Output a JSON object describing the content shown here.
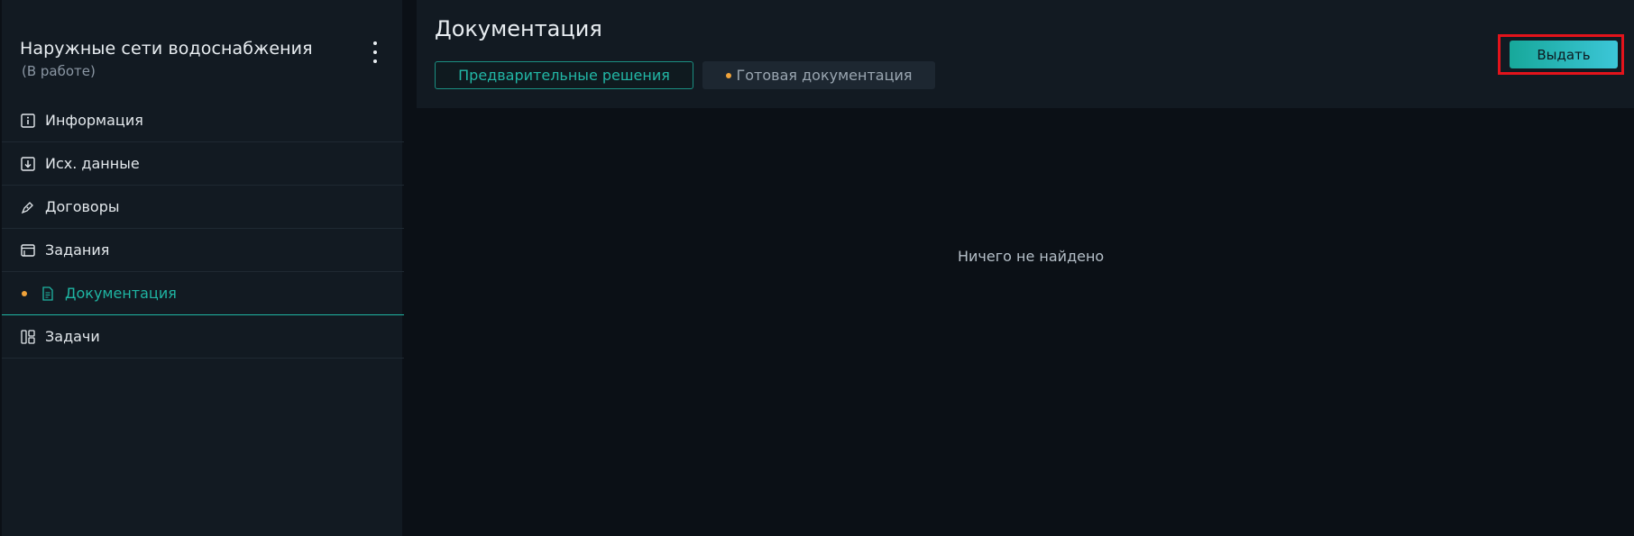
{
  "sidebar": {
    "project_title": "Наружные сети водоснабжения",
    "project_status": "(В работе)",
    "menu_icon": "kebab-menu-icon",
    "items": [
      {
        "label": "Информация",
        "icon": "info-icon"
      },
      {
        "label": "Исх. данные",
        "icon": "download-box-icon"
      },
      {
        "label": "Договоры",
        "icon": "pen-icon"
      },
      {
        "label": "Задания",
        "icon": "window-icon"
      },
      {
        "label": "Документация",
        "icon": "document-icon",
        "active": true
      },
      {
        "label": "Задачи",
        "icon": "kanban-icon"
      }
    ]
  },
  "main": {
    "title": "Документация",
    "tabs": [
      {
        "label": "Предварительные решения",
        "selected": true
      },
      {
        "label": "Готовая документация",
        "has_indicator": true
      }
    ],
    "issue_button_label": "Выдать",
    "empty_message": "Ничего не найдено"
  },
  "colors": {
    "accent": "#1fb5a3",
    "indicator": "#f0a33a",
    "highlight_border": "#e3131b",
    "sidebar_bg": "#121a22",
    "page_bg": "#0b1016"
  }
}
